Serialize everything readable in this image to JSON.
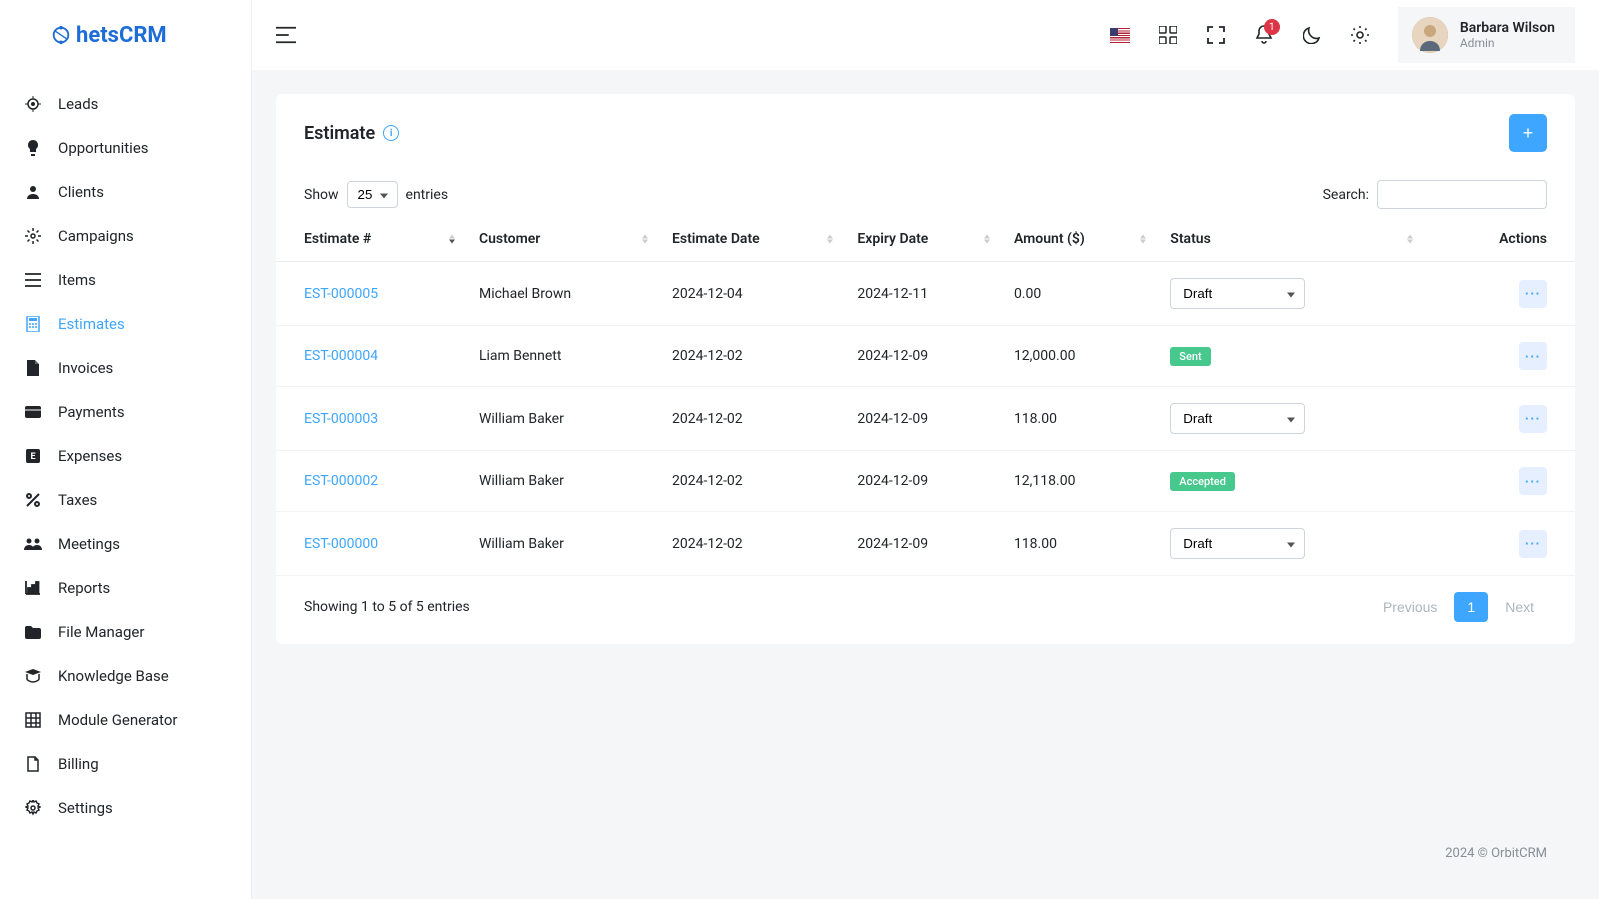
{
  "brand": "hetsCRM",
  "sidebar": {
    "items": [
      {
        "label": "Leads",
        "icon": "leads-icon",
        "active": false
      },
      {
        "label": "Opportunities",
        "icon": "opportunities-icon",
        "active": false
      },
      {
        "label": "Clients",
        "icon": "clients-icon",
        "active": false
      },
      {
        "label": "Campaigns",
        "icon": "campaigns-icon",
        "active": false
      },
      {
        "label": "Items",
        "icon": "items-icon",
        "active": false
      },
      {
        "label": "Estimates",
        "icon": "estimates-icon",
        "active": true
      },
      {
        "label": "Invoices",
        "icon": "invoices-icon",
        "active": false
      },
      {
        "label": "Payments",
        "icon": "payments-icon",
        "active": false
      },
      {
        "label": "Expenses",
        "icon": "expenses-icon",
        "active": false
      },
      {
        "label": "Taxes",
        "icon": "taxes-icon",
        "active": false
      },
      {
        "label": "Meetings",
        "icon": "meetings-icon",
        "active": false
      },
      {
        "label": "Reports",
        "icon": "reports-icon",
        "active": false
      },
      {
        "label": "File Manager",
        "icon": "file-manager-icon",
        "active": false
      },
      {
        "label": "Knowledge Base",
        "icon": "knowledge-base-icon",
        "active": false
      },
      {
        "label": "Module Generator",
        "icon": "module-generator-icon",
        "active": false
      },
      {
        "label": "Billing",
        "icon": "billing-icon",
        "active": false
      },
      {
        "label": "Settings",
        "icon": "settings-icon",
        "active": false
      }
    ]
  },
  "header": {
    "notification_count": "1",
    "user_name": "Barbara Wilson",
    "user_role": "Admin"
  },
  "page": {
    "title": "Estimate",
    "show_label": "Show",
    "entries_label": "entries",
    "entries_value": "25",
    "search_label": "Search:",
    "columns": [
      "Estimate #",
      "Customer",
      "Estimate Date",
      "Expiry Date",
      "Amount ($)",
      "Status",
      "Actions"
    ],
    "rows": [
      {
        "estimate_no": "EST-000005",
        "customer": "Michael Brown",
        "estimate_date": "2024-12-04",
        "expiry_date": "2024-12-11",
        "amount": "0.00",
        "status_type": "select",
        "status_value": "Draft"
      },
      {
        "estimate_no": "EST-000004",
        "customer": "Liam Bennett",
        "estimate_date": "2024-12-02",
        "expiry_date": "2024-12-09",
        "amount": "12,000.00",
        "status_type": "badge",
        "status_value": "Sent",
        "badge_class": "badge-sent"
      },
      {
        "estimate_no": "EST-000003",
        "customer": "William Baker",
        "estimate_date": "2024-12-02",
        "expiry_date": "2024-12-09",
        "amount": "118.00",
        "status_type": "select",
        "status_value": "Draft"
      },
      {
        "estimate_no": "EST-000002",
        "customer": "William Baker",
        "estimate_date": "2024-12-02",
        "expiry_date": "2024-12-09",
        "amount": "12,118.00",
        "status_type": "badge",
        "status_value": "Accepted",
        "badge_class": "badge-accepted"
      },
      {
        "estimate_no": "EST-000000",
        "customer": "William Baker",
        "estimate_date": "2024-12-02",
        "expiry_date": "2024-12-09",
        "amount": "118.00",
        "status_type": "select",
        "status_value": "Draft"
      }
    ],
    "showing_text": "Showing 1 to 5 of 5 entries",
    "pagination": {
      "previous": "Previous",
      "next": "Next",
      "pages": [
        "1"
      ],
      "current": "1"
    }
  },
  "footer": "2024 © OrbitCRM"
}
